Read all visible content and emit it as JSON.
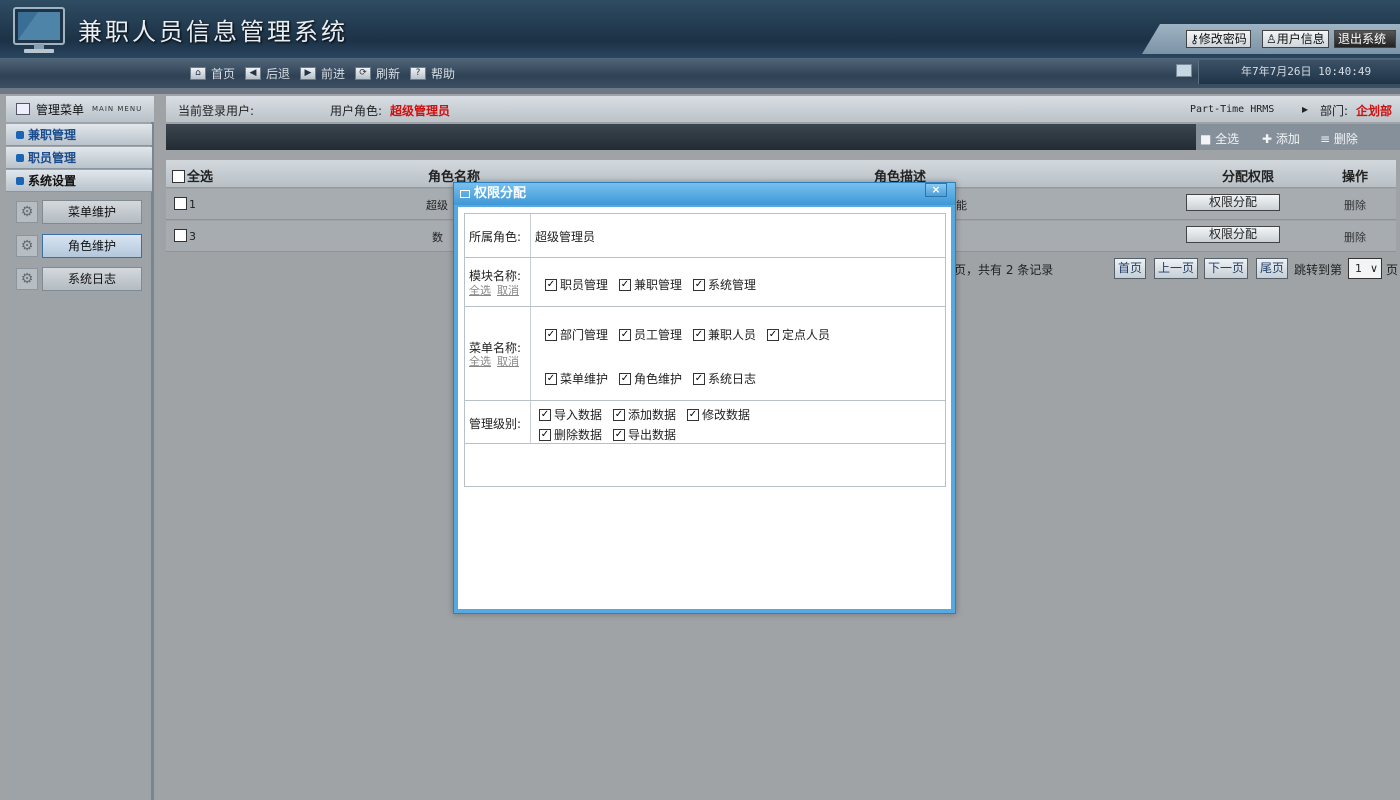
{
  "header": {
    "app_title": "兼职人员信息管理系统",
    "buttons": [
      "修改密码",
      "用户信息",
      "退出系统"
    ]
  },
  "nav": {
    "items": [
      {
        "icon": "home-icon",
        "glyph": "⌂",
        "label": "首页"
      },
      {
        "icon": "back-icon",
        "glyph": "◀",
        "label": "后退"
      },
      {
        "icon": "forward-icon",
        "glyph": "▶",
        "label": "前进"
      },
      {
        "icon": "refresh-icon",
        "glyph": "⟳",
        "label": "刷新"
      },
      {
        "icon": "help-icon",
        "glyph": "?",
        "label": "帮助"
      }
    ],
    "datetime": "年7年7月26日 10:40:49"
  },
  "sidebar": {
    "title": "管理菜单",
    "title_en": "MAIN MENU",
    "groups": [
      "兼职管理",
      "职员管理",
      "系统设置"
    ],
    "items": [
      "菜单维护",
      "角色维护",
      "系统日志"
    ],
    "active_item": "角色维护"
  },
  "info": {
    "current_user_label": "当前登录用户:",
    "role_label": "用户角色:",
    "role_value": "超级管理员",
    "system_en": "Part-Time HRMS",
    "dept_label": "部门:",
    "dept_value": "企划部"
  },
  "toolbar": {
    "select_all": "全选",
    "add": "添加",
    "delete": "删除"
  },
  "grid": {
    "headers": {
      "select_all": "全选",
      "role_name": "角色名称",
      "role_desc": "角色描述",
      "assign": "分配权限",
      "ops": "操作"
    },
    "rows": [
      {
        "id": "1",
        "name": "超级",
        "desc": "能",
        "assign": "权限分配",
        "op": "删除"
      },
      {
        "id": "3",
        "name": "数",
        "desc": "",
        "assign": "权限分配",
        "op": "删除"
      }
    ]
  },
  "pager": {
    "summary": "页，共有 2 条记录",
    "first": "首页",
    "prev": "上一页",
    "next": "下一页",
    "last": "尾页",
    "jump_label": "跳转到第",
    "page": "1",
    "page_suffix": "页"
  },
  "modal": {
    "title": "权限分配",
    "close": "×",
    "role_label": "所属角色:",
    "role_value": "超级管理员",
    "module_label": "模块名称:",
    "menu_label": "菜单名称:",
    "level_label": "管理级别:",
    "select_all": "全选",
    "cancel": "取消",
    "modules": [
      "职员管理",
      "兼职管理",
      "系统管理"
    ],
    "menus_row1": [
      "部门管理",
      "员工管理",
      "兼职人员",
      "定点人员"
    ],
    "menus_row2": [
      "菜单维护",
      "角色维护",
      "系统日志"
    ],
    "levels_row1": [
      "导入数据",
      "添加数据",
      "修改数据"
    ],
    "levels_row2": [
      "删除数据",
      "导出数据"
    ]
  },
  "colors": {
    "header_bg": "#1c3246",
    "accent_blue": "#3f98d6",
    "role_red": "#d01010",
    "group_blue": "#1a4b8c"
  }
}
